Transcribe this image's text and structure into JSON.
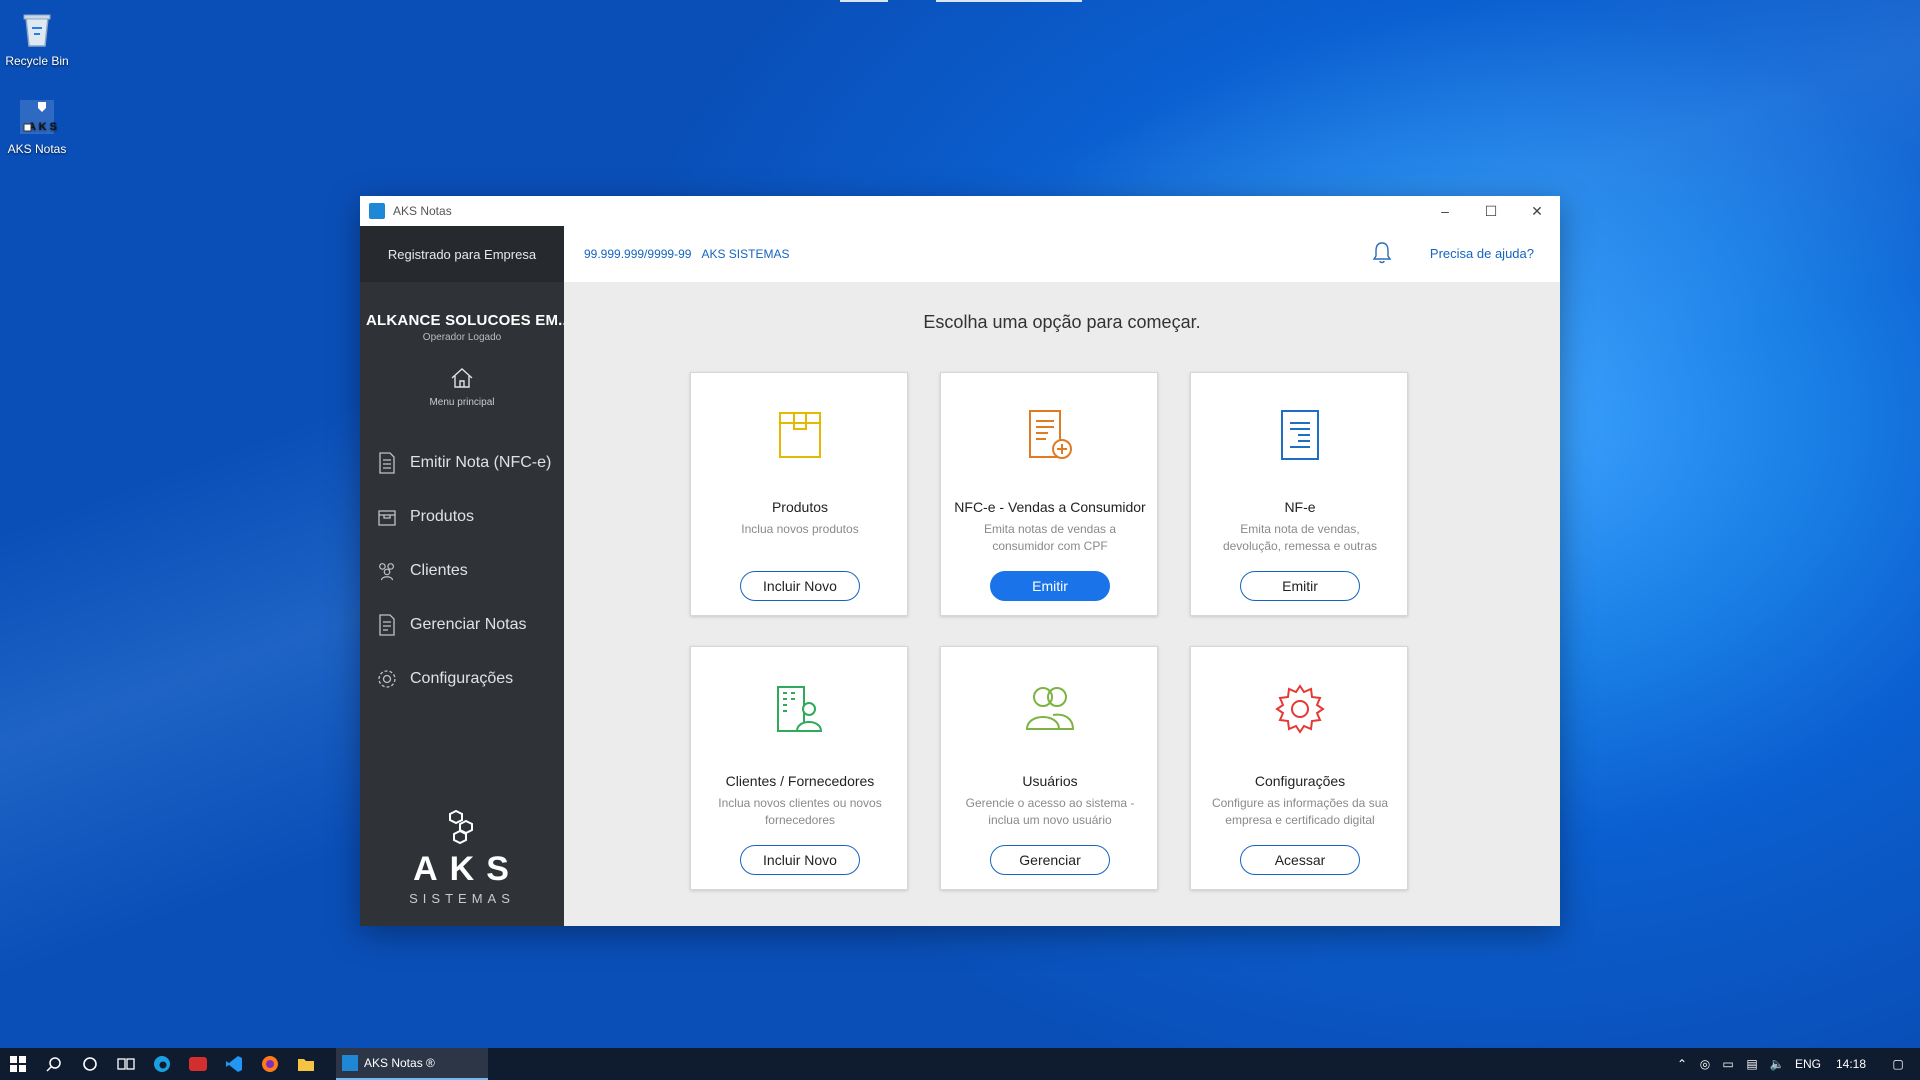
{
  "desktop": {
    "icons": [
      {
        "label": "Recycle Bin",
        "icon": "recycle-bin-icon"
      },
      {
        "label": "AKS Notas",
        "icon": "aks-notas-icon"
      }
    ]
  },
  "window": {
    "title": "AKS Notas",
    "controls": {
      "minimize": "–",
      "maximize": "☐",
      "close": "✕"
    }
  },
  "sidebar": {
    "registered": "Registrado para Empresa",
    "company": "ALKANCE SOLUCOES EM...",
    "operator": "Operador Logado",
    "home_label": "Menu principal",
    "items": [
      {
        "label": "Emitir Nota (NFC-e)",
        "icon": "document-icon"
      },
      {
        "label": "Produtos",
        "icon": "box-icon"
      },
      {
        "label": "Clientes",
        "icon": "users-icon"
      },
      {
        "label": "Gerenciar Notas",
        "icon": "notes-icon"
      },
      {
        "label": "Configurações",
        "icon": "gear-icon"
      }
    ],
    "brand": {
      "name": "AKS",
      "sub": "SISTEMAS"
    }
  },
  "header": {
    "cnpj": "99.999.999/9999-99",
    "company": "AKS SISTEMAS",
    "help": "Precisa de ajuda?"
  },
  "main": {
    "heading": "Escolha uma opção para começar.",
    "cards": [
      {
        "title": "Produtos",
        "desc": "Inclua novos produtos",
        "button": "Incluir Novo",
        "color": "#e6b800"
      },
      {
        "title": "NFC-e - Vendas a Consumidor",
        "desc": "Emita notas de vendas a consumidor com CPF",
        "button": "Emitir",
        "color": "#e07b24"
      },
      {
        "title": "NF-e",
        "desc": "Emita nota de vendas, devolução, remessa e outras",
        "button": "Emitir",
        "color": "#1e6fc4"
      },
      {
        "title": "Clientes / Fornecedores",
        "desc": "Inclua novos clientes ou novos fornecedores",
        "button": "Incluir Novo",
        "color": "#2eaa5a"
      },
      {
        "title": "Usuários",
        "desc": "Gerencie o acesso ao sistema - inclua um novo usuário",
        "button": "Gerenciar",
        "color": "#7cb342"
      },
      {
        "title": "Configurações",
        "desc": "Configure as informações da sua empresa e certificado digital",
        "button": "Acessar",
        "color": "#e53935"
      }
    ]
  },
  "taskbar": {
    "app_label": "AKS Notas ®",
    "language": "ENG",
    "time": "14:18"
  }
}
